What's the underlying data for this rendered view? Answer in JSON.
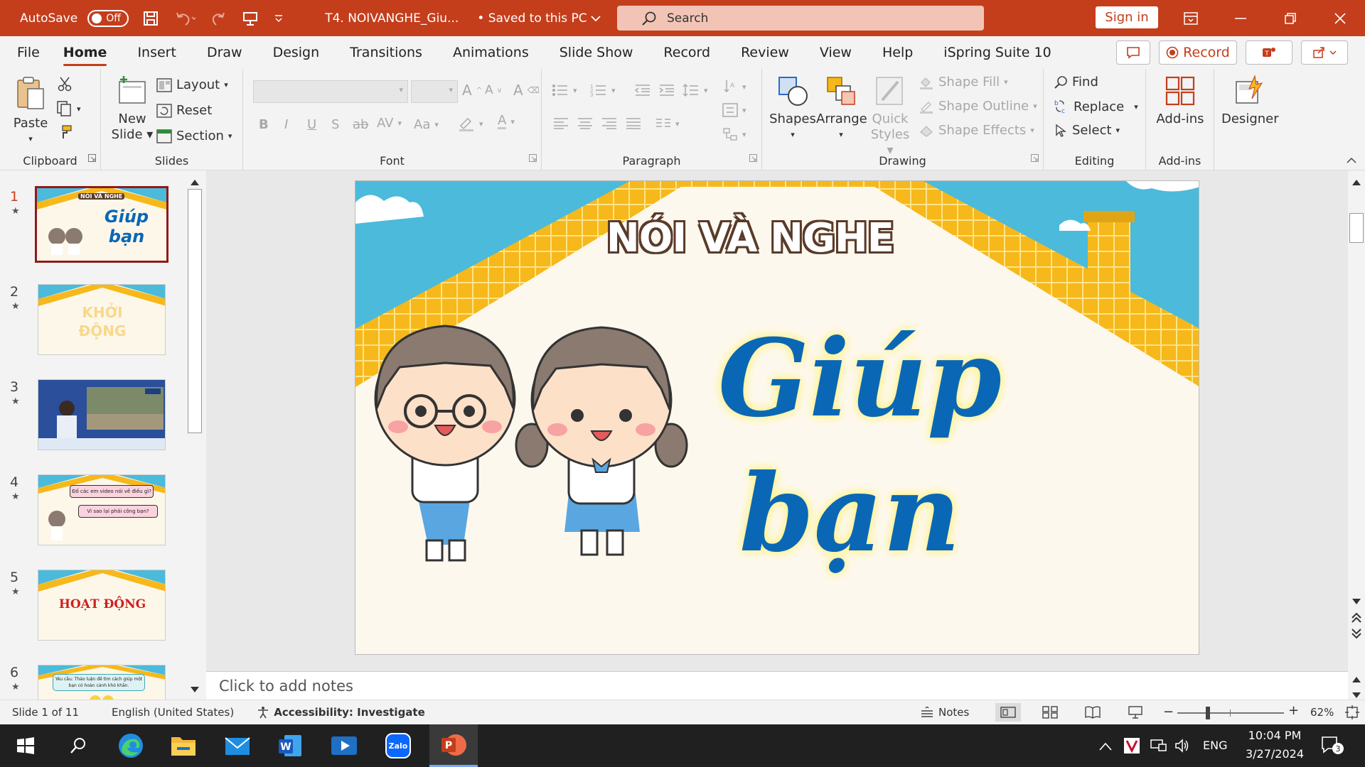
{
  "titlebar": {
    "autosave_label": "AutoSave",
    "autosave_state": "Off",
    "doc_title": "T4. NOIVANGHE_Giu...",
    "save_status": "• Saved to this PC",
    "search_placeholder": "Search",
    "signin_label": "Sign in"
  },
  "tabs": [
    "File",
    "Home",
    "Insert",
    "Draw",
    "Design",
    "Transitions",
    "Animations",
    "Slide Show",
    "Record",
    "Review",
    "View",
    "Help",
    "iSpring Suite 10"
  ],
  "tab_right": {
    "record_label": "Record"
  },
  "ribbon": {
    "clipboard": {
      "label": "Clipboard",
      "paste": "Paste"
    },
    "slides": {
      "label": "Slides",
      "new_slide": "New",
      "new_slide2": "Slide",
      "layout": "Layout",
      "reset": "Reset",
      "section": "Section"
    },
    "font": {
      "label": "Font"
    },
    "paragraph": {
      "label": "Paragraph"
    },
    "drawing": {
      "label": "Drawing",
      "shapes": "Shapes",
      "arrange": "Arrange",
      "quick_styles": "Quick",
      "quick_styles2": "Styles",
      "shape_fill": "Shape Fill",
      "shape_outline": "Shape Outline",
      "shape_effects": "Shape Effects"
    },
    "editing": {
      "label": "Editing",
      "find": "Find",
      "replace": "Replace",
      "select": "Select"
    },
    "addins": {
      "label": "Add-ins",
      "addins_btn": "Add-ins",
      "designer": "Designer"
    }
  },
  "thumbnails": [
    {
      "num": "1",
      "text": "Giúp bạn",
      "caption": "NÓI VÀ NGHE"
    },
    {
      "num": "2",
      "text": "KHỞI ĐỘNG"
    },
    {
      "num": "3",
      "text": ""
    },
    {
      "num": "4",
      "text": "Đố các em video nói về điều gì?",
      "text2": "Vì sao lại phải công bạn?"
    },
    {
      "num": "5",
      "text": "HOẠT ĐỘNG"
    },
    {
      "num": "6",
      "text": "Yêu cầu: Thảo luận đề tìm cách giúp một bạn có hoàn cảnh khó khăn."
    }
  ],
  "slide": {
    "header": "NÓI VÀ NGHE",
    "title_line1": "Giúp",
    "title_line2": "bạn"
  },
  "notes_placeholder": "Click to add notes",
  "statusbar": {
    "slide_info": "Slide 1 of 11",
    "language": "English (United States)",
    "accessibility": "Accessibility: Investigate",
    "notes": "Notes",
    "zoom": "62%"
  },
  "taskbar": {
    "lang": "ENG",
    "time": "10:04 PM",
    "date": "3/27/2024",
    "notif_count": "3",
    "zalo": "Zalo"
  },
  "colors": {
    "accent": "#c43e1c",
    "slide_blue": "#0a67b5",
    "sky": "#4bbadb",
    "roof": "#f6b81a"
  }
}
